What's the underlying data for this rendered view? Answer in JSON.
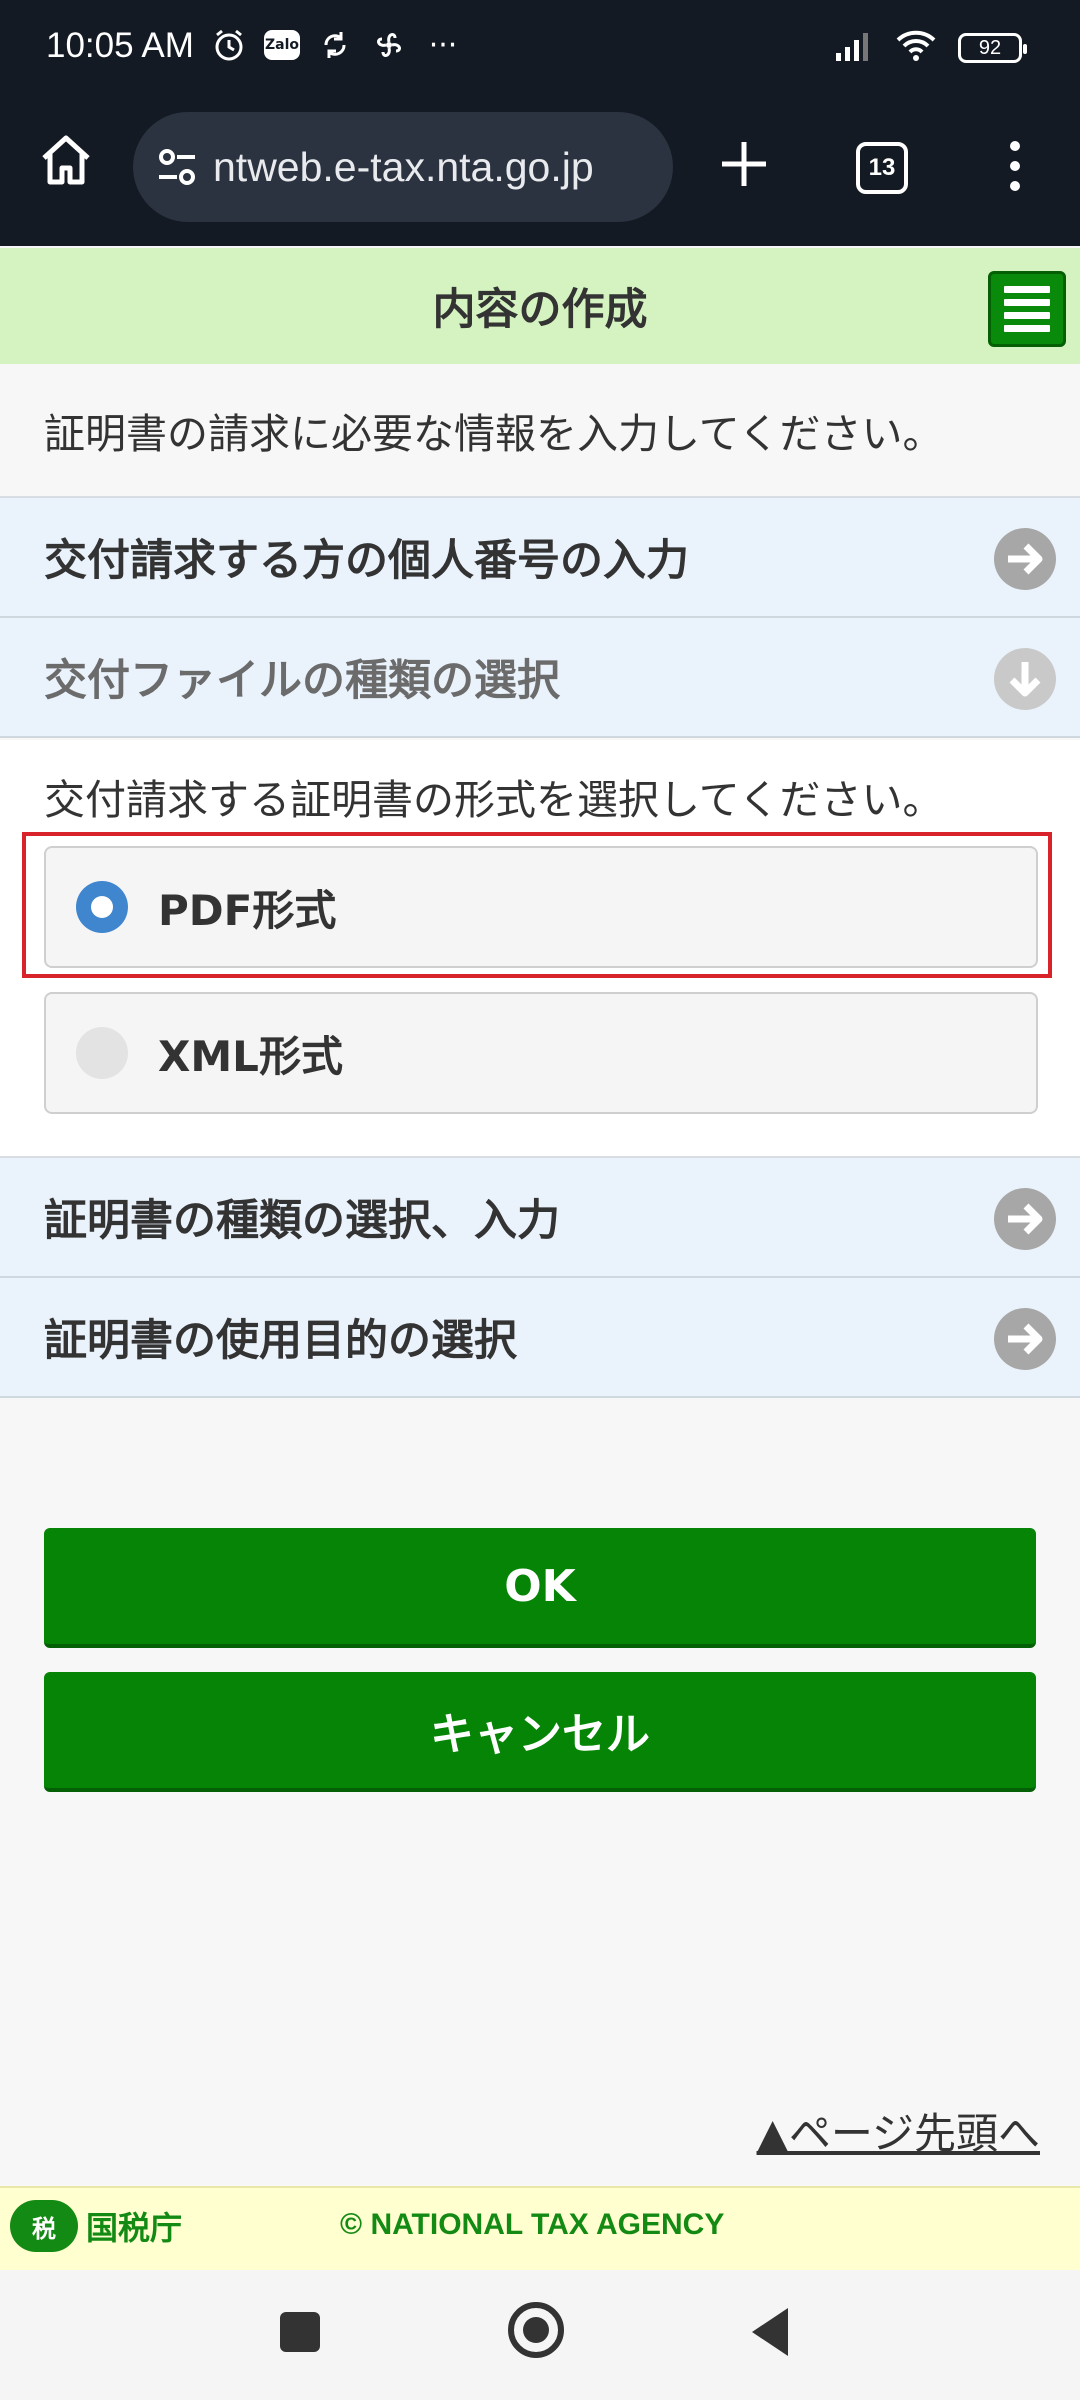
{
  "status_bar": {
    "time": "10:05 AM",
    "zalo_label": "Zalo",
    "more": "···",
    "battery": "92"
  },
  "browser": {
    "url": "ntweb.e-tax.nta.go.jp",
    "tab_count": "13"
  },
  "header": {
    "title": "内容の作成"
  },
  "intro_text": "証明書の請求に必要な情報を入力してください。",
  "sections": {
    "personal_number": "交付請求する方の個人番号の入力",
    "file_type": "交付ファイルの種類の選択",
    "cert_type": "証明書の種類の選択、入力",
    "purpose": "証明書の使用目的の選択"
  },
  "file_type_panel": {
    "prompt": "交付請求する証明書の形式を選択してください。",
    "options": [
      {
        "label": "PDF形式",
        "selected": true
      },
      {
        "label": "XML形式",
        "selected": false
      }
    ]
  },
  "buttons": {
    "ok": "OK",
    "cancel": "キャンセル"
  },
  "page_top_link": "▲ページ先頭へ",
  "footer": {
    "logo_mark": "税",
    "logo_text": "国税庁",
    "copyright": "© NATIONAL TAX AGENCY"
  },
  "colors": {
    "header_bg": "#d4f3c0",
    "button_green": "#068406",
    "section_bg": "#eaf3fc",
    "highlight_red": "#d8232a",
    "radio_selected": "#3f86cf"
  }
}
